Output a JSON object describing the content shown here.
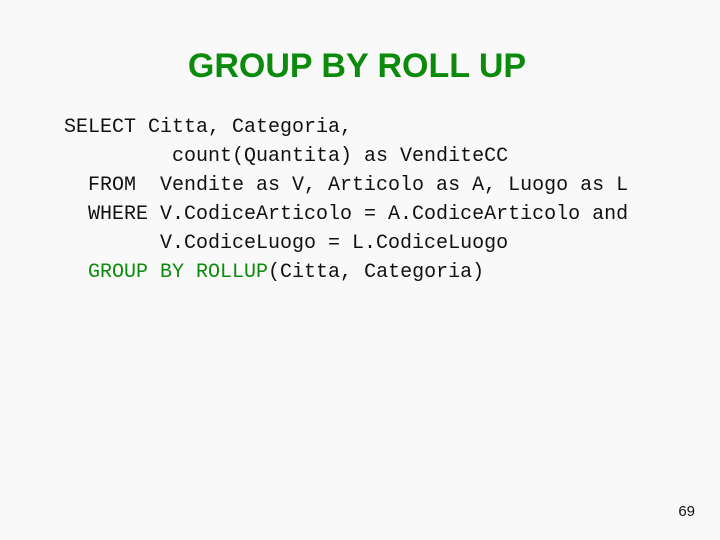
{
  "slide": {
    "title": "GROUP BY ROLL UP",
    "page_number": "69",
    "accent_color": "#0b8a0b"
  },
  "code": {
    "lines": [
      {
        "prefix": "SELECT Citta, Categoria,",
        "highlight": "",
        "suffix": ""
      },
      {
        "prefix": "         count(Quantita) as VenditeCC",
        "highlight": "",
        "suffix": ""
      },
      {
        "prefix": "  FROM  Vendite as V, Articolo as A, Luogo as L",
        "highlight": "",
        "suffix": ""
      },
      {
        "prefix": "  WHERE V.CodiceArticolo = A.CodiceArticolo and",
        "highlight": "",
        "suffix": ""
      },
      {
        "prefix": "        V.CodiceLuogo = L.CodiceLuogo",
        "highlight": "",
        "suffix": ""
      },
      {
        "prefix": "  ",
        "highlight": "GROUP BY ROLLUP",
        "suffix": "(Citta, Categoria)"
      }
    ]
  }
}
